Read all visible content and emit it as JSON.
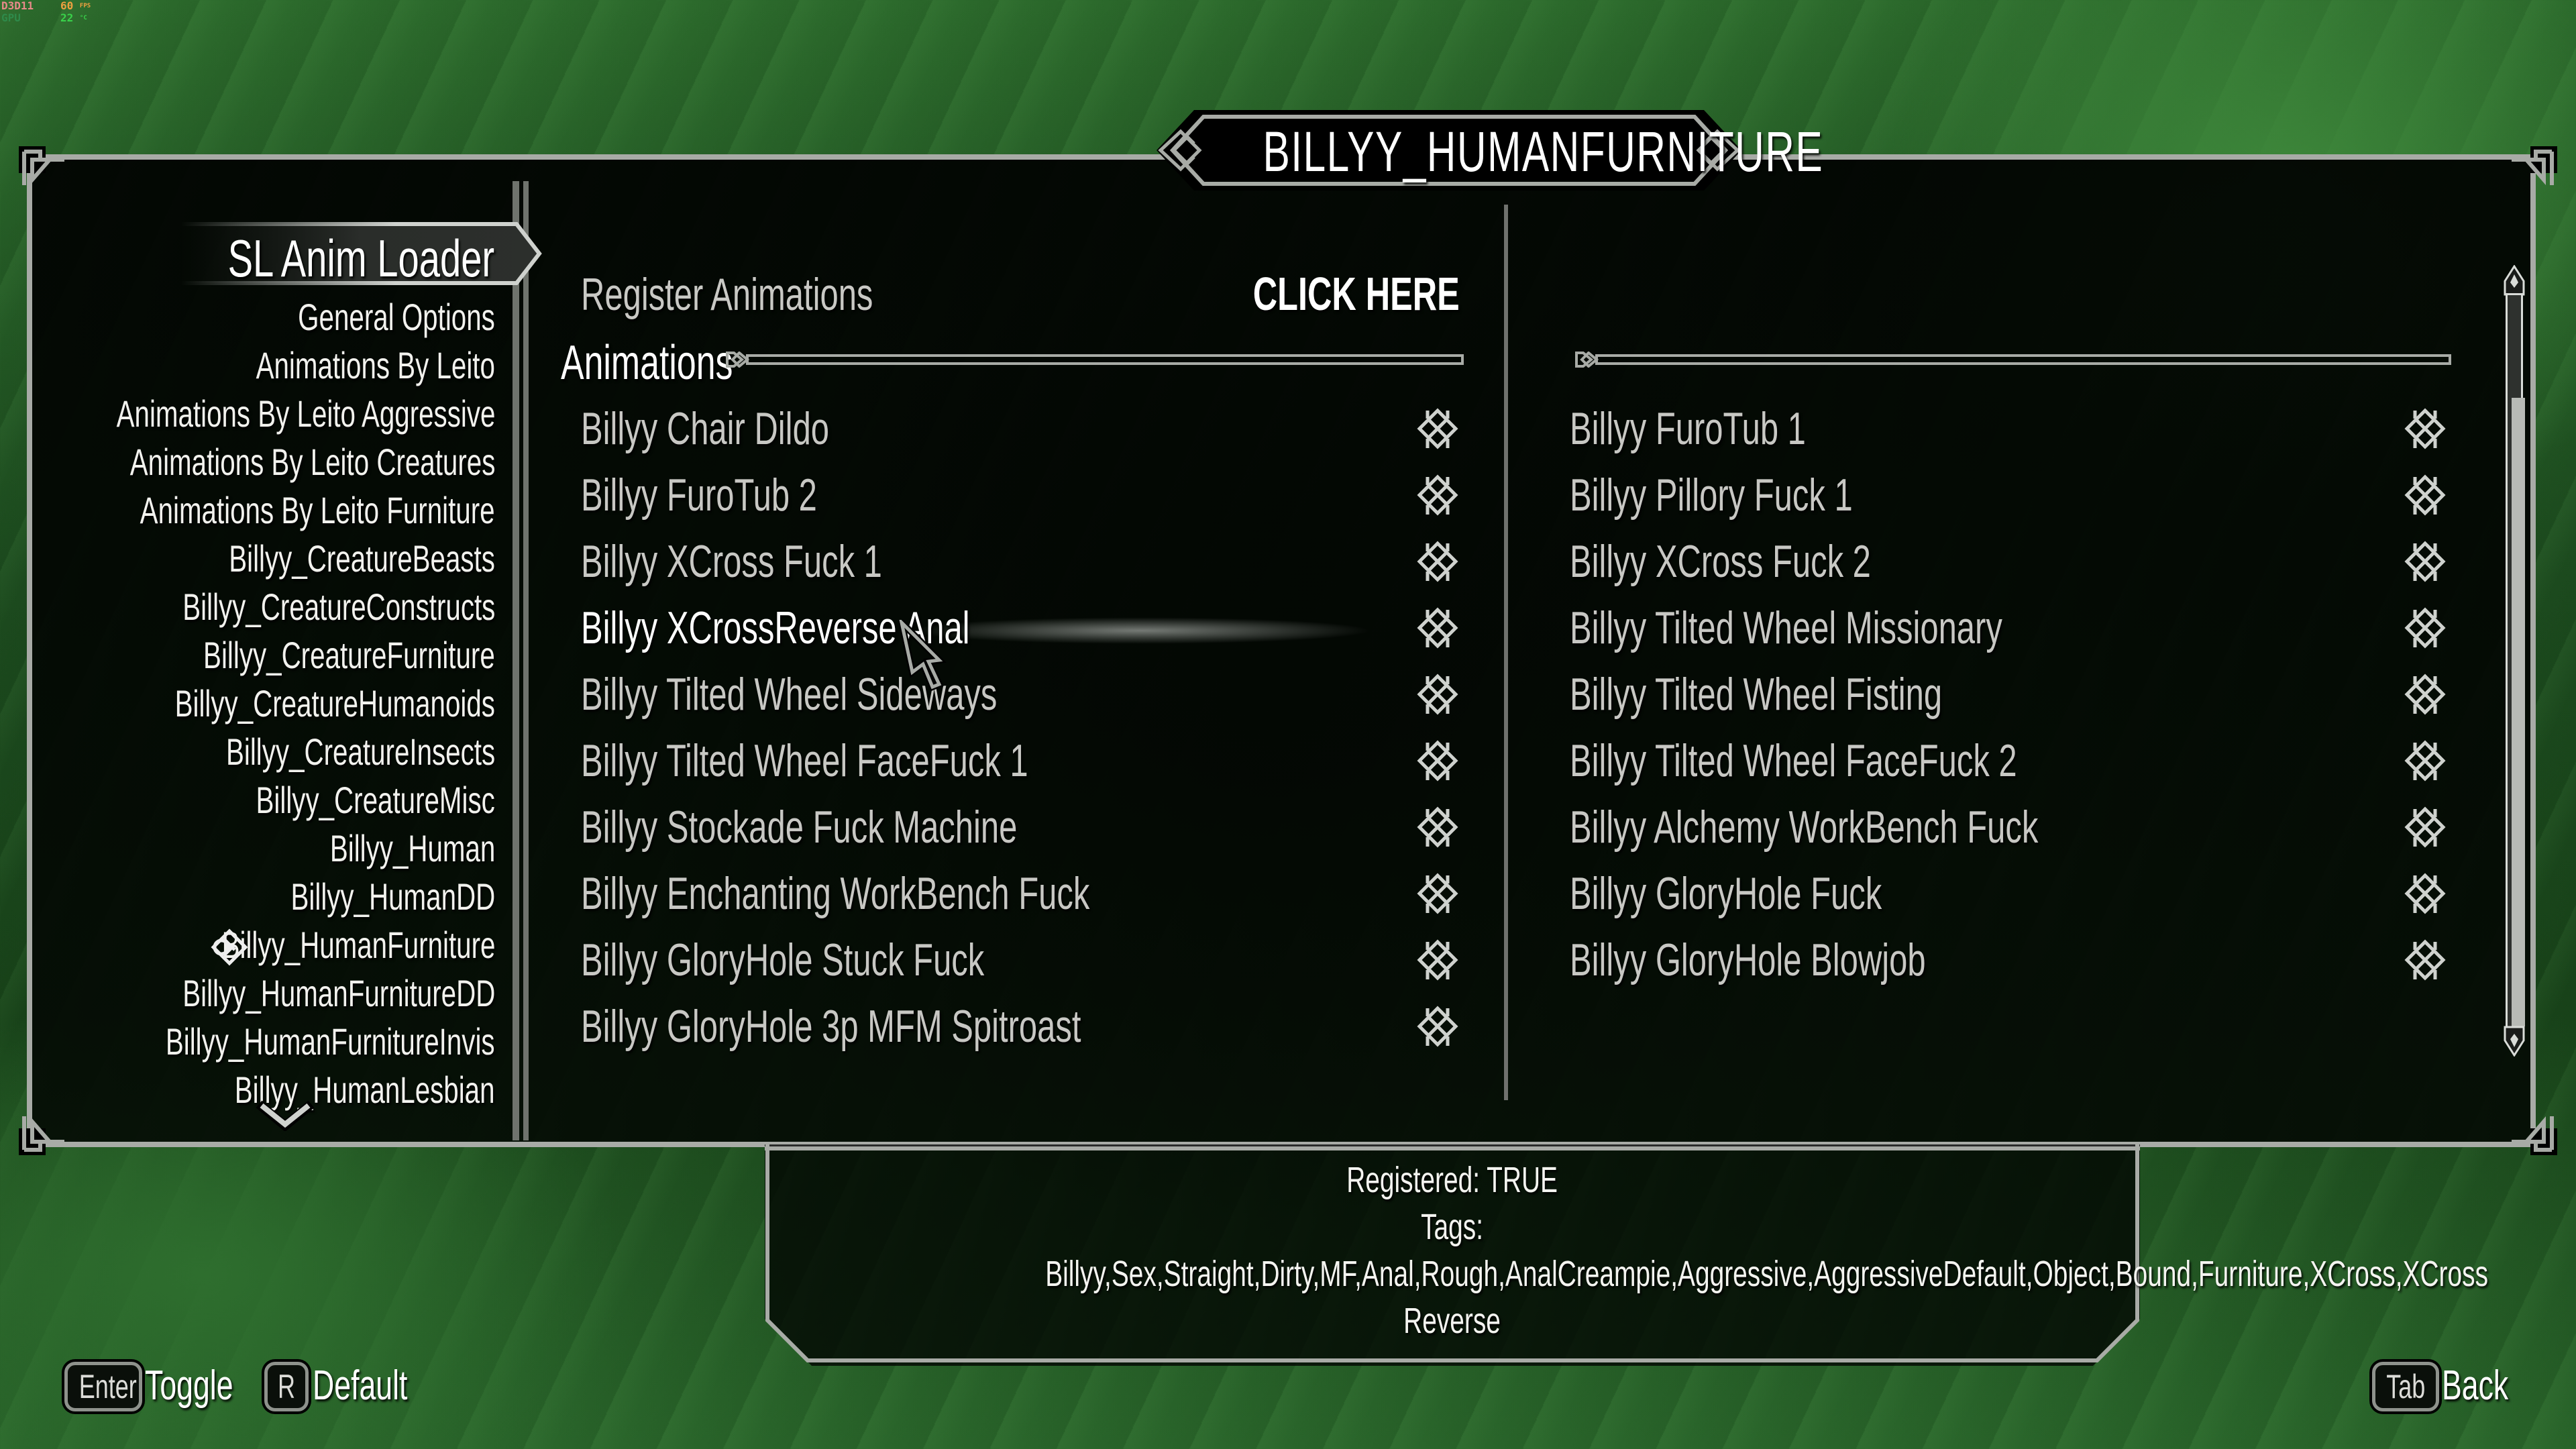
{
  "hud": {
    "api": "D3D11",
    "fps_value": "60",
    "fps_unit": "FPS",
    "gpu_label": "GPU",
    "temp_value": "22",
    "temp_unit": "°C"
  },
  "title": "BILLYY_HUMANFURNITURE",
  "sidebar": {
    "header": "SL Anim Loader",
    "items": [
      {
        "label": "General Options"
      },
      {
        "label": "Animations By Leito"
      },
      {
        "label": "Animations By Leito Aggressive"
      },
      {
        "label": "Animations By Leito Creatures"
      },
      {
        "label": "Animations By Leito Furniture"
      },
      {
        "label": "Billyy_CreatureBeasts"
      },
      {
        "label": "Billyy_CreatureConstructs"
      },
      {
        "label": "Billyy_CreatureFurniture"
      },
      {
        "label": "Billyy_CreatureHumanoids"
      },
      {
        "label": "Billyy_CreatureInsects"
      },
      {
        "label": "Billyy_CreatureMisc"
      },
      {
        "label": "Billyy_Human"
      },
      {
        "label": "Billyy_HumanDD"
      },
      {
        "label": "Billyy_HumanFurniture",
        "selected": true
      },
      {
        "label": "Billyy_HumanFurnitureDD"
      },
      {
        "label": "Billyy_HumanFurnitureInvis"
      },
      {
        "label": "Billyy_HumanLesbian"
      }
    ],
    "more_indicator_icon": "chevron-down-icon"
  },
  "main": {
    "register": {
      "label": "Register Animations",
      "button": "CLICK HERE"
    },
    "section_header": "Animations",
    "left_column": [
      {
        "label": "Billyy Chair Dildo",
        "checked": false
      },
      {
        "label": "Billyy FuroTub 2",
        "checked": false
      },
      {
        "label": "Billyy XCross Fuck 1",
        "checked": false
      },
      {
        "label": "Billyy XCrossReverse Anal",
        "checked": false,
        "highlighted": true
      },
      {
        "label": "Billyy Tilted Wheel Sideways",
        "checked": false
      },
      {
        "label": "Billyy Tilted Wheel FaceFuck 1",
        "checked": false
      },
      {
        "label": "Billyy Stockade Fuck Machine",
        "checked": false
      },
      {
        "label": "Billyy Enchanting WorkBench Fuck",
        "checked": false
      },
      {
        "label": "Billyy GloryHole Stuck Fuck",
        "checked": false
      },
      {
        "label": "Billyy GloryHole 3p MFM Spitroast",
        "checked": false
      }
    ],
    "right_column": [
      {
        "label": "Billyy FuroTub 1",
        "checked": false
      },
      {
        "label": "Billyy Pillory Fuck 1",
        "checked": false
      },
      {
        "label": "Billyy XCross Fuck 2",
        "checked": false
      },
      {
        "label": "Billyy Tilted Wheel Missionary",
        "checked": false
      },
      {
        "label": "Billyy Tilted Wheel Fisting",
        "checked": false
      },
      {
        "label": "Billyy Tilted Wheel FaceFuck 2",
        "checked": false
      },
      {
        "label": "Billyy Alchemy WorkBench Fuck",
        "checked": false
      },
      {
        "label": "Billyy GloryHole Fuck",
        "checked": false
      },
      {
        "label": "Billyy GloryHole Blowjob",
        "checked": false
      }
    ],
    "scrollbar": {
      "thumb_start_fraction": 0.14,
      "thumb_end_fraction": 1.0
    }
  },
  "info": {
    "registered": "Registered: TRUE",
    "tags_label": "Tags:",
    "tags_line1": "Billyy,Sex,Straight,Dirty,MF,Anal,Rough,AnalCreampie,Aggressive,AggressiveDefault,Object,Bound,Furniture,XCross,XCross",
    "tags_line2": "Reverse"
  },
  "key_hints": {
    "toggle": {
      "key": "Enter",
      "label": "Toggle"
    },
    "default": {
      "key": "R",
      "label": "Default"
    },
    "back": {
      "key": "Tab",
      "label": "Back"
    }
  },
  "colors": {
    "frame": "#a8aba6",
    "text_primary": "#ffffff",
    "text_option": "#c8c8c4",
    "panel_bg": "#000000"
  }
}
